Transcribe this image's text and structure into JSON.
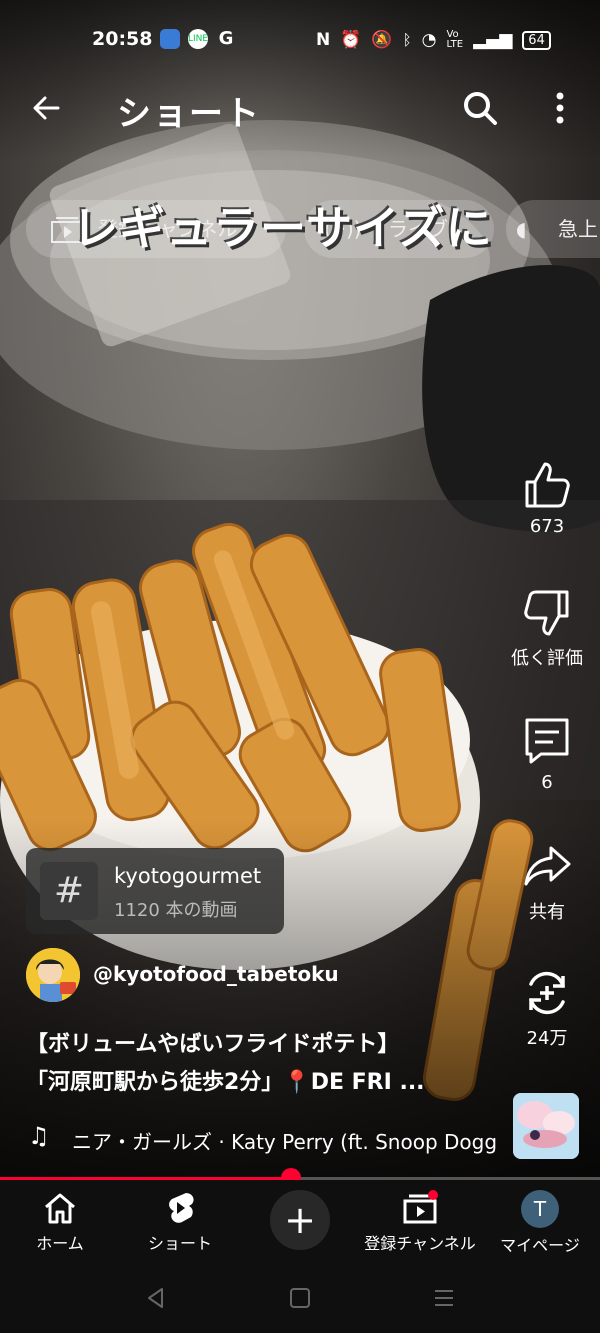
{
  "status_bar": {
    "time": "20:58",
    "battery": "64"
  },
  "header": {
    "title": "ショート"
  },
  "chips": [
    {
      "label": "登録チャンネル"
    },
    {
      "label": "ライブ"
    },
    {
      "label": "急上"
    }
  ],
  "video": {
    "overlay_text": "レギュラーサイズに"
  },
  "actions": {
    "like_count": "673",
    "dislike_label": "低く評価",
    "comment_count": "6",
    "share_label": "共有",
    "remix_count": "24万"
  },
  "hashtag": {
    "symbol": "#",
    "name": "kyotogourmet",
    "count": "1120 本の動画"
  },
  "channel": {
    "handle": "@kyotofood_tabetoku"
  },
  "caption": {
    "line1": "【ボリュームやばいフライドポテト】",
    "line2": "「河原町駅から徒歩2分」📍DE FRI ..."
  },
  "music": {
    "song": "ニア・ガールズ · Katy Perry (ft. Snoop Dogg)"
  },
  "progress": {
    "fraction": 0.485
  },
  "bottom_nav": {
    "home": "ホーム",
    "shorts": "ショート",
    "create": "+",
    "subscriptions": "登録チャンネル",
    "account": "マイページ",
    "account_initial": "T"
  },
  "colors": {
    "accent": "#ff0033",
    "background": "#0f0f0f"
  }
}
